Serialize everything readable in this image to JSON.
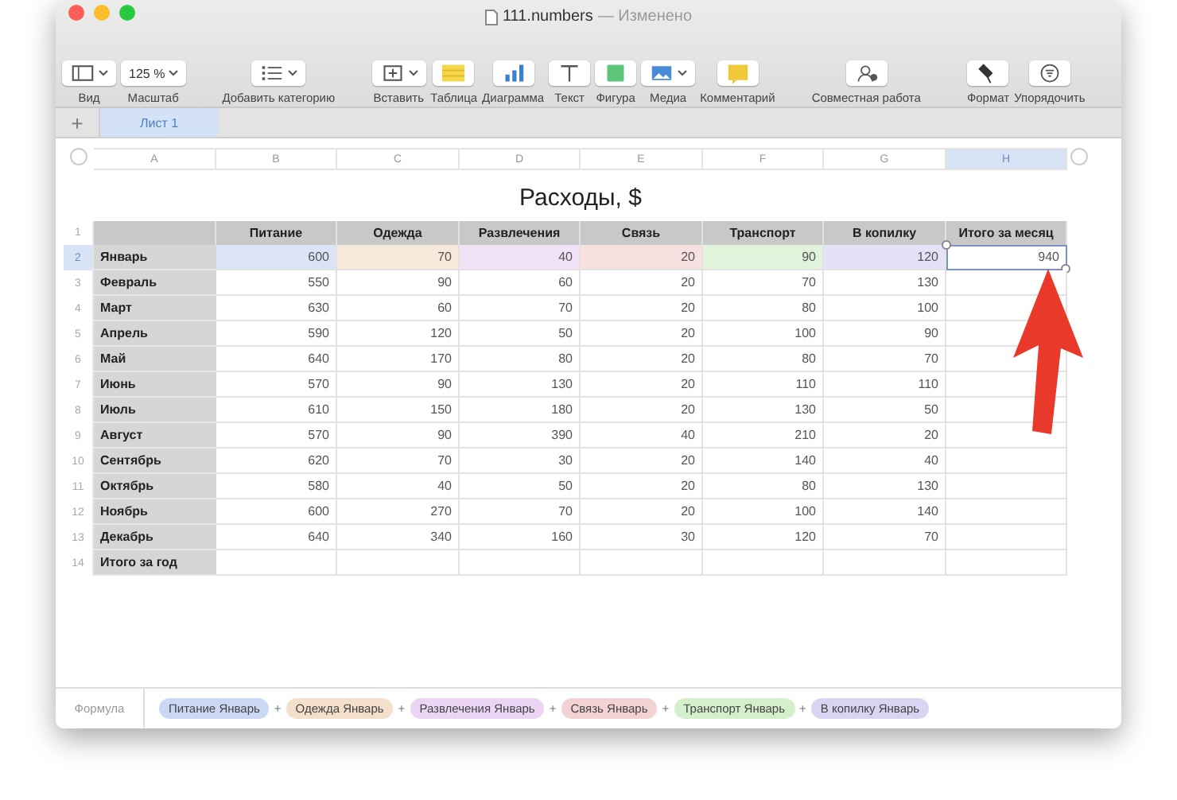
{
  "window": {
    "title": "111.numbers",
    "status": "— Изменено"
  },
  "toolbar": [
    {
      "kind": "view",
      "label": "Вид"
    },
    {
      "kind": "zoom",
      "label": "Масштаб",
      "value": "125 %"
    },
    {
      "kind": "category",
      "label": "Добавить категорию"
    },
    {
      "kind": "insert",
      "label": "Вставить"
    },
    {
      "kind": "table",
      "label": "Таблица"
    },
    {
      "kind": "chart",
      "label": "Диаграмма"
    },
    {
      "kind": "text",
      "label": "Текст"
    },
    {
      "kind": "shape",
      "label": "Фигура"
    },
    {
      "kind": "media",
      "label": "Медиа"
    },
    {
      "kind": "comment",
      "label": "Комментарий"
    },
    {
      "kind": "collaborate",
      "label": "Совместная работа"
    },
    {
      "kind": "format",
      "label": "Формат"
    },
    {
      "kind": "organize",
      "label": "Упорядочить"
    }
  ],
  "sheets": {
    "add": "+",
    "tabs": [
      {
        "label": "Лист 1",
        "selected": true
      }
    ]
  },
  "column_headers": [
    {
      "label": "A",
      "selected": false
    },
    {
      "label": "B",
      "selected": false
    },
    {
      "label": "C",
      "selected": false
    },
    {
      "label": "D",
      "selected": false
    },
    {
      "label": "E",
      "selected": false
    },
    {
      "label": "F",
      "selected": false
    },
    {
      "label": "G",
      "selected": false
    },
    {
      "label": "H",
      "selected": true
    }
  ],
  "table": {
    "title": "Расходы, $",
    "header_row_number": "1",
    "columns": [
      "Питание",
      "Одежда",
      "Развлечения",
      "Связь",
      "Транспорт",
      "В копилку",
      "Итого за месяц"
    ],
    "rows": [
      {
        "number": "2",
        "label": "Январь",
        "selected": true,
        "referenced": true,
        "cells": [
          "600",
          "70",
          "40",
          "20",
          "90",
          "120",
          "940"
        ]
      },
      {
        "number": "3",
        "label": "Февраль",
        "selected": false,
        "referenced": false,
        "cells": [
          "550",
          "90",
          "60",
          "20",
          "70",
          "130"
        ]
      },
      {
        "number": "4",
        "label": "Март",
        "selected": false,
        "referenced": false,
        "cells": [
          "630",
          "60",
          "70",
          "20",
          "80",
          "100"
        ]
      },
      {
        "number": "5",
        "label": "Апрель",
        "selected": false,
        "referenced": false,
        "cells": [
          "590",
          "120",
          "50",
          "20",
          "100",
          "90"
        ]
      },
      {
        "number": "6",
        "label": "Май",
        "selected": false,
        "referenced": false,
        "cells": [
          "640",
          "170",
          "80",
          "20",
          "80",
          "70"
        ]
      },
      {
        "number": "7",
        "label": "Июнь",
        "selected": false,
        "referenced": false,
        "cells": [
          "570",
          "90",
          "130",
          "20",
          "110",
          "110"
        ]
      },
      {
        "number": "8",
        "label": "Июль",
        "selected": false,
        "referenced": false,
        "cells": [
          "610",
          "150",
          "180",
          "20",
          "130",
          "50"
        ]
      },
      {
        "number": "9",
        "label": "Август",
        "selected": false,
        "referenced": false,
        "cells": [
          "570",
          "90",
          "390",
          "40",
          "210",
          "20"
        ]
      },
      {
        "number": "10",
        "label": "Сентябрь",
        "selected": false,
        "referenced": false,
        "cells": [
          "620",
          "70",
          "30",
          "20",
          "140",
          "40"
        ]
      },
      {
        "number": "11",
        "label": "Октябрь",
        "selected": false,
        "referenced": false,
        "cells": [
          "580",
          "40",
          "50",
          "20",
          "80",
          "130"
        ]
      },
      {
        "number": "12",
        "label": "Ноябрь",
        "selected": false,
        "referenced": false,
        "cells": [
          "600",
          "270",
          "70",
          "20",
          "100",
          "140"
        ]
      },
      {
        "number": "13",
        "label": "Декабрь",
        "selected": false,
        "referenced": false,
        "cells": [
          "640",
          "340",
          "160",
          "30",
          "120",
          "70"
        ]
      },
      {
        "number": "14",
        "label": "Итого за год",
        "selected": false,
        "referenced": false,
        "cells": []
      }
    ]
  },
  "formula": {
    "label": "Формула",
    "items": [
      {
        "kind": "reference",
        "text": "Питание Январь",
        "color": "#cbd8f4"
      },
      {
        "kind": "operator",
        "text": "+"
      },
      {
        "kind": "reference",
        "text": "Одежда Январь",
        "color": "#f4dfca"
      },
      {
        "kind": "operator",
        "text": "+"
      },
      {
        "kind": "reference",
        "text": "Развлечения Январь",
        "color": "#ecd5f4"
      },
      {
        "kind": "operator",
        "text": "+"
      },
      {
        "kind": "reference",
        "text": "Связь Январь",
        "color": "#f2d2d2"
      },
      {
        "kind": "operator",
        "text": "+"
      },
      {
        "kind": "reference",
        "text": "Транспорт Январь",
        "color": "#d4efcb"
      },
      {
        "kind": "operator",
        "text": "+"
      },
      {
        "kind": "reference",
        "text": "В копилку Январь",
        "color": "#d7d5f2"
      }
    ]
  }
}
